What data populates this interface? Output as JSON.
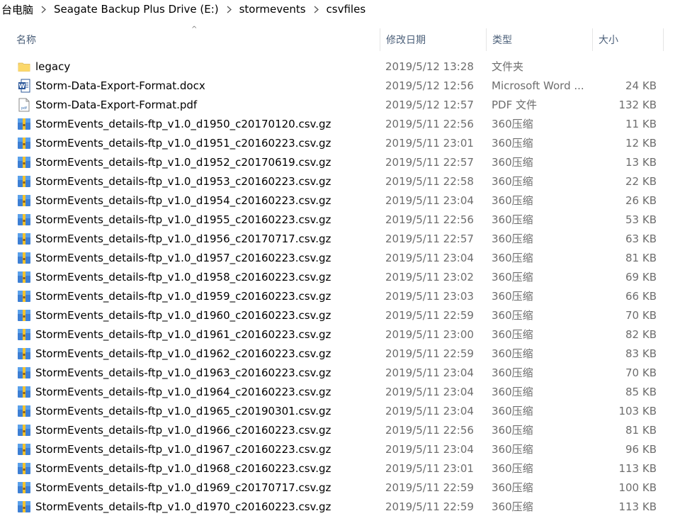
{
  "breadcrumb": [
    "台电脑",
    "Seagate Backup Plus Drive (E:)",
    "stormevents",
    "csvfiles"
  ],
  "columns": {
    "name": "名称",
    "date": "修改日期",
    "type": "类型",
    "size": "大小"
  },
  "icons": {
    "folder": "folder-icon",
    "word": "word-doc-icon",
    "pdf": "pdf-file-icon",
    "archive": "archive-icon"
  },
  "files": [
    {
      "icon": "folder",
      "name": "legacy",
      "date": "2019/5/12 13:28",
      "type": "文件夹",
      "size": ""
    },
    {
      "icon": "word",
      "name": "Storm-Data-Export-Format.docx",
      "date": "2019/5/12 12:56",
      "type": "Microsoft Word ...",
      "size": "24 KB"
    },
    {
      "icon": "pdf",
      "name": "Storm-Data-Export-Format.pdf",
      "date": "2019/5/12 12:57",
      "type": "PDF 文件",
      "size": "132 KB"
    },
    {
      "icon": "archive",
      "name": "StormEvents_details-ftp_v1.0_d1950_c20170120.csv.gz",
      "date": "2019/5/11 22:56",
      "type": "360压缩",
      "size": "11 KB"
    },
    {
      "icon": "archive",
      "name": "StormEvents_details-ftp_v1.0_d1951_c20160223.csv.gz",
      "date": "2019/5/11 23:01",
      "type": "360压缩",
      "size": "12 KB"
    },
    {
      "icon": "archive",
      "name": "StormEvents_details-ftp_v1.0_d1952_c20170619.csv.gz",
      "date": "2019/5/11 22:57",
      "type": "360压缩",
      "size": "13 KB"
    },
    {
      "icon": "archive",
      "name": "StormEvents_details-ftp_v1.0_d1953_c20160223.csv.gz",
      "date": "2019/5/11 22:58",
      "type": "360压缩",
      "size": "22 KB"
    },
    {
      "icon": "archive",
      "name": "StormEvents_details-ftp_v1.0_d1954_c20160223.csv.gz",
      "date": "2019/5/11 23:04",
      "type": "360压缩",
      "size": "26 KB"
    },
    {
      "icon": "archive",
      "name": "StormEvents_details-ftp_v1.0_d1955_c20160223.csv.gz",
      "date": "2019/5/11 22:56",
      "type": "360压缩",
      "size": "53 KB"
    },
    {
      "icon": "archive",
      "name": "StormEvents_details-ftp_v1.0_d1956_c20170717.csv.gz",
      "date": "2019/5/11 22:57",
      "type": "360压缩",
      "size": "63 KB"
    },
    {
      "icon": "archive",
      "name": "StormEvents_details-ftp_v1.0_d1957_c20160223.csv.gz",
      "date": "2019/5/11 23:04",
      "type": "360压缩",
      "size": "81 KB"
    },
    {
      "icon": "archive",
      "name": "StormEvents_details-ftp_v1.0_d1958_c20160223.csv.gz",
      "date": "2019/5/11 23:02",
      "type": "360压缩",
      "size": "69 KB"
    },
    {
      "icon": "archive",
      "name": "StormEvents_details-ftp_v1.0_d1959_c20160223.csv.gz",
      "date": "2019/5/11 23:03",
      "type": "360压缩",
      "size": "66 KB"
    },
    {
      "icon": "archive",
      "name": "StormEvents_details-ftp_v1.0_d1960_c20160223.csv.gz",
      "date": "2019/5/11 22:59",
      "type": "360压缩",
      "size": "70 KB"
    },
    {
      "icon": "archive",
      "name": "StormEvents_details-ftp_v1.0_d1961_c20160223.csv.gz",
      "date": "2019/5/11 23:00",
      "type": "360压缩",
      "size": "82 KB"
    },
    {
      "icon": "archive",
      "name": "StormEvents_details-ftp_v1.0_d1962_c20160223.csv.gz",
      "date": "2019/5/11 22:59",
      "type": "360压缩",
      "size": "83 KB"
    },
    {
      "icon": "archive",
      "name": "StormEvents_details-ftp_v1.0_d1963_c20160223.csv.gz",
      "date": "2019/5/11 23:04",
      "type": "360压缩",
      "size": "70 KB"
    },
    {
      "icon": "archive",
      "name": "StormEvents_details-ftp_v1.0_d1964_c20160223.csv.gz",
      "date": "2019/5/11 23:04",
      "type": "360压缩",
      "size": "85 KB"
    },
    {
      "icon": "archive",
      "name": "StormEvents_details-ftp_v1.0_d1965_c20190301.csv.gz",
      "date": "2019/5/11 23:04",
      "type": "360压缩",
      "size": "103 KB"
    },
    {
      "icon": "archive",
      "name": "StormEvents_details-ftp_v1.0_d1966_c20160223.csv.gz",
      "date": "2019/5/11 22:56",
      "type": "360压缩",
      "size": "81 KB"
    },
    {
      "icon": "archive",
      "name": "StormEvents_details-ftp_v1.0_d1967_c20160223.csv.gz",
      "date": "2019/5/11 23:04",
      "type": "360压缩",
      "size": "96 KB"
    },
    {
      "icon": "archive",
      "name": "StormEvents_details-ftp_v1.0_d1968_c20160223.csv.gz",
      "date": "2019/5/11 23:01",
      "type": "360压缩",
      "size": "113 KB"
    },
    {
      "icon": "archive",
      "name": "StormEvents_details-ftp_v1.0_d1969_c20170717.csv.gz",
      "date": "2019/5/11 22:59",
      "type": "360压缩",
      "size": "100 KB"
    },
    {
      "icon": "archive",
      "name": "StormEvents_details-ftp_v1.0_d1970_c20160223.csv.gz",
      "date": "2019/5/11 22:59",
      "type": "360压缩",
      "size": "113 KB"
    }
  ]
}
